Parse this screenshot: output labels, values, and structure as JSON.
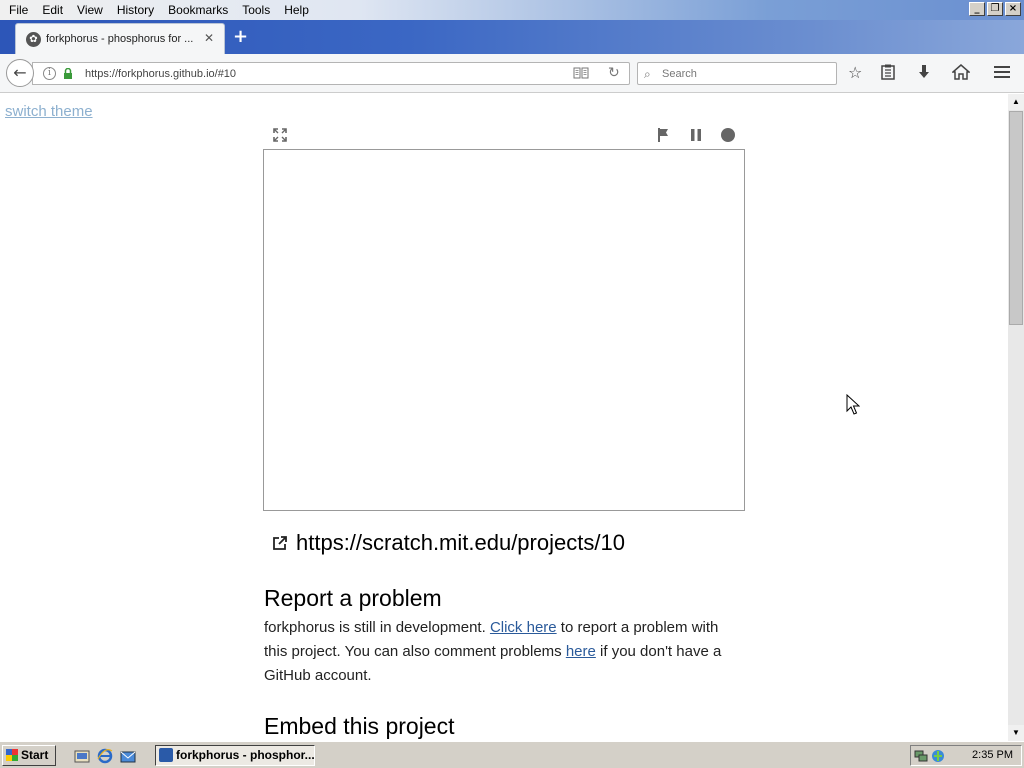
{
  "menu": [
    "File",
    "Edit",
    "View",
    "History",
    "Bookmarks",
    "Tools",
    "Help"
  ],
  "tab": {
    "title": "forkphorus - phosphorus for ...",
    "close": "✕"
  },
  "newtab": "+",
  "nav": {
    "url": "https://forkphorus.github.io/#10",
    "search_placeholder": "Search"
  },
  "content": {
    "switch_theme": "switch theme",
    "project_link": "https://scratch.mit.edu/projects/10",
    "report_heading": "Report a problem",
    "report_text_1": "forkphorus is still in development. ",
    "report_link_1": "Click here",
    "report_text_2": " to report a problem with this project. You can also comment problems ",
    "report_link_2": "here",
    "report_text_3": " if you don't have a GitHub account.",
    "embed_heading": "Embed this project"
  },
  "taskbar": {
    "start": "Start",
    "task_label": "forkphorus - phosphor...",
    "clock": "2:35 PM"
  },
  "icons": {
    "fullscreen": "fullscreen-icon",
    "flag": "green-flag-icon",
    "pause": "pause-icon",
    "stop": "stop-icon",
    "external": "external-link-icon"
  }
}
